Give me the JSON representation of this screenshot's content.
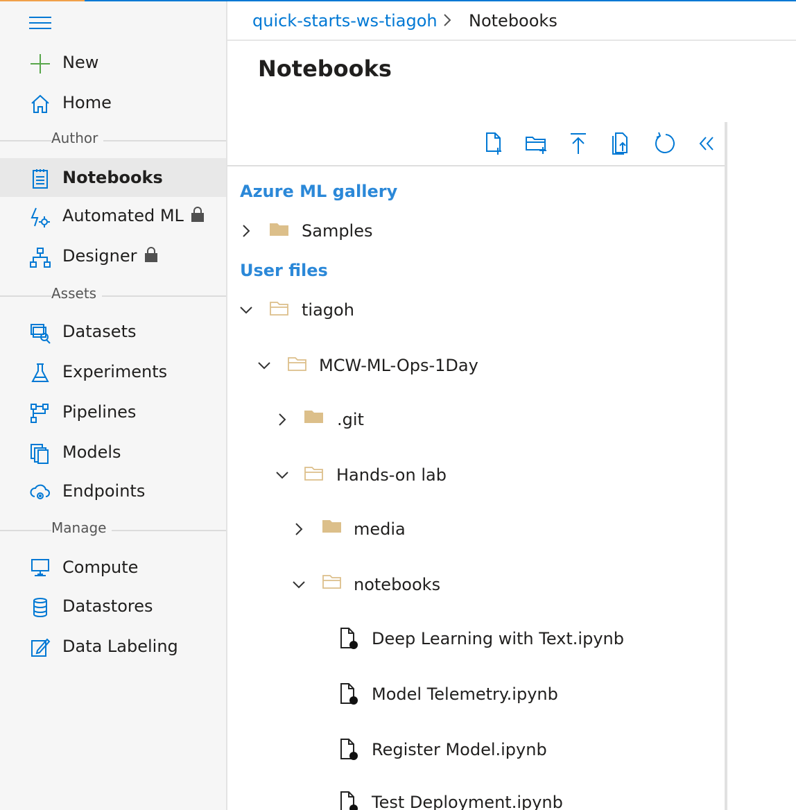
{
  "sidebar": {
    "new_label": "New",
    "home_label": "Home",
    "sections": {
      "author": "Author",
      "assets": "Assets",
      "manage": "Manage"
    },
    "items": {
      "notebooks": "Notebooks",
      "automated_ml": "Automated ML",
      "designer": "Designer",
      "datasets": "Datasets",
      "experiments": "Experiments",
      "pipelines": "Pipelines",
      "models": "Models",
      "endpoints": "Endpoints",
      "compute": "Compute",
      "datastores": "Datastores",
      "data_labeling": "Data Labeling"
    },
    "selected": "notebooks"
  },
  "breadcrumb": {
    "workspace": "quick-starts-ws-tiagoh",
    "current": "Notebooks"
  },
  "page_title": "Notebooks",
  "toolbar": [
    "new-file-icon",
    "new-folder-icon",
    "upload-icon",
    "upload-folder-icon",
    "refresh-icon",
    "collapse-icon"
  ],
  "tree": {
    "gallery_label": "Azure ML gallery",
    "samples": "Samples",
    "user_files_label": "User files",
    "user": "tiagoh",
    "repo": "MCW-ML-Ops-1Day",
    "git": ".git",
    "lab": "Hands-on lab",
    "media": "media",
    "notebooks_folder": "notebooks",
    "files": [
      "Deep Learning with Text.ipynb",
      "Model Telemetry.ipynb",
      "Register Model.ipynb",
      "Test Deployment.ipynb"
    ]
  },
  "colors": {
    "accent": "#0078d4",
    "folder": "#dcbf8a",
    "new_plus": "#57a64a",
    "section_blue": "#2b88d8"
  }
}
